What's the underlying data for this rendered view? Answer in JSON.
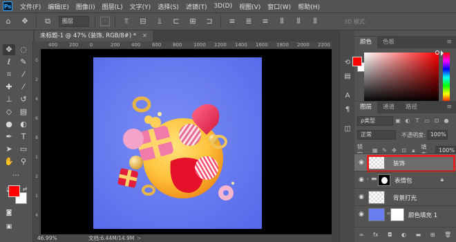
{
  "app": {
    "logo": "Ps"
  },
  "menu": [
    "文件(F)",
    "编辑(E)",
    "图像(I)",
    "图层(L)",
    "文字(Y)",
    "选择(S)",
    "滤镜(T)",
    "3D(D)",
    "视图(V)",
    "窗口(W)",
    "帮助(H)"
  ],
  "options_bar": {
    "auto_select_target": "图层",
    "mode_3d_label": "3D 模式:"
  },
  "document": {
    "tab_title": "未标题-1 @ 47% (装饰, RGB/8#) *",
    "tab_close": "×"
  },
  "rulers": {
    "top_ticks": [
      "400",
      "200",
      "0",
      "200",
      "400",
      "600",
      "800",
      "1000",
      "1200",
      "1400",
      "1600",
      "1800",
      "2000",
      "2200"
    ],
    "left_ticks": [
      "0",
      "2",
      "4",
      "6",
      "8",
      "1",
      "2",
      "1",
      "4"
    ]
  },
  "status": {
    "zoom": "46.99%",
    "doc_size": "文档:6.44M/14.9M",
    "arrow": ">"
  },
  "color_panel": {
    "tabs": [
      "颜色",
      "色板"
    ],
    "foreground": "#ff0000",
    "background": "#ffffff"
  },
  "layers_panel": {
    "tabs": [
      "图层",
      "通道",
      "路径"
    ],
    "filter_kind": "ρ类型",
    "blend_mode": "正常",
    "opacity_label": "不透明度:",
    "opacity_value": "100%",
    "lock_label": "锁定:",
    "fill_label": "填充:",
    "fill_value": "100%",
    "layers": [
      {
        "name": "装饰",
        "selected": true,
        "highlighted": true
      },
      {
        "name": "表情包",
        "selected": false,
        "group": true,
        "locked": true
      },
      {
        "name": "背景打光",
        "selected": false
      },
      {
        "name": "颜色填充 1",
        "selected": false
      }
    ]
  },
  "colors": {
    "accent_red": "#e52421",
    "canvas_blue": "#6a7df0"
  },
  "icons": {
    "left_tools": [
      "move-icon",
      "marquee-icon",
      "lasso-icon",
      "quick-select-icon",
      "crop-icon",
      "eyedropper-icon",
      "healing-icon",
      "brush-icon",
      "stamp-icon",
      "history-brush-icon",
      "eraser-icon",
      "gradient-icon",
      "blur-icon",
      "dodge-icon",
      "pen-icon",
      "type-icon",
      "path-select-icon",
      "rectangle-icon",
      "hand-icon",
      "zoom-icon",
      "more-tools-icon"
    ]
  }
}
